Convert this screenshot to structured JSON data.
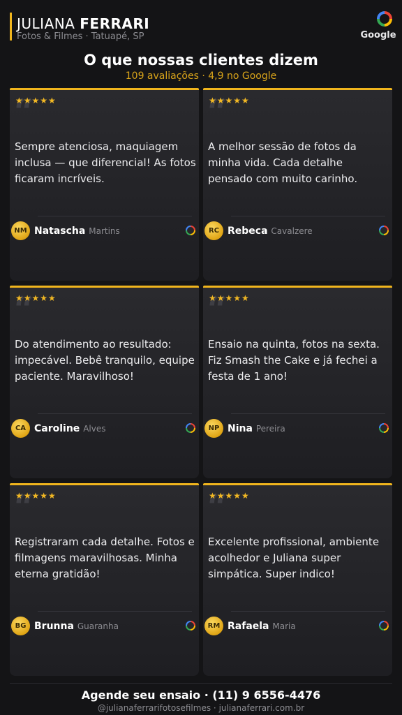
{
  "header": {
    "brand_first": "JULIANA",
    "brand_last": "FERRARI",
    "tagline": "Fotos & Filmes",
    "location": "Tatuapé, SP",
    "google_label": "Google"
  },
  "section": {
    "title": "O que nossas clientes dizem",
    "review_count": "109 avaliações",
    "rating": "4,9 no Google"
  },
  "reviews": [
    {
      "stars": "★★★★★",
      "quote": "“",
      "text": "Sempre atenciosa, maquiagem inclusa — que diferencial! As fotos ficaram incríveis.",
      "initials": "NM",
      "first": "Natascha",
      "last": "Martins"
    },
    {
      "stars": "★★★★★",
      "quote": "“",
      "text": "A melhor sessão de fotos da minha vida. Cada detalhe pensado com muito carinho.",
      "initials": "RC",
      "first": "Rebeca",
      "last": "Cavalzere"
    },
    {
      "stars": "★★★★★",
      "quote": "“",
      "text": "Do atendimento ao resultado: impecável. Bebê tranquilo, equipe paciente. Maravilhoso!",
      "initials": "CA",
      "first": "Caroline",
      "last": "Alves"
    },
    {
      "stars": "★★★★★",
      "quote": "“",
      "text": "Ensaio na quinta, fotos na sexta. Fiz Smash the Cake e já fechei a festa de 1 ano!",
      "initials": "NP",
      "first": "Nina",
      "last": "Pereira"
    },
    {
      "stars": "★★★★★",
      "quote": "“",
      "text": "Registraram cada detalhe. Fotos e filmagens maravilhosas. Minha eterna gratidão!",
      "initials": "BG",
      "first": "Brunna",
      "last": "Guaranha"
    },
    {
      "stars": "★★★★★",
      "quote": "“",
      "text": "Excelente profissional, ambiente acolhedor e Juliana super simpática. Super indico!",
      "initials": "RM",
      "first": "Rafaela",
      "last": "Maria"
    }
  ],
  "footer": {
    "cta_label": "Agende seu ensaio",
    "phone": "(11) 9 6556-4476",
    "instagram": "@julianaferrarifotosefilmes",
    "website": "julianaferrari.com.br"
  },
  "colors": {
    "accent": "#f0b51d",
    "background": "#141416",
    "card": "#2a2a2e"
  }
}
